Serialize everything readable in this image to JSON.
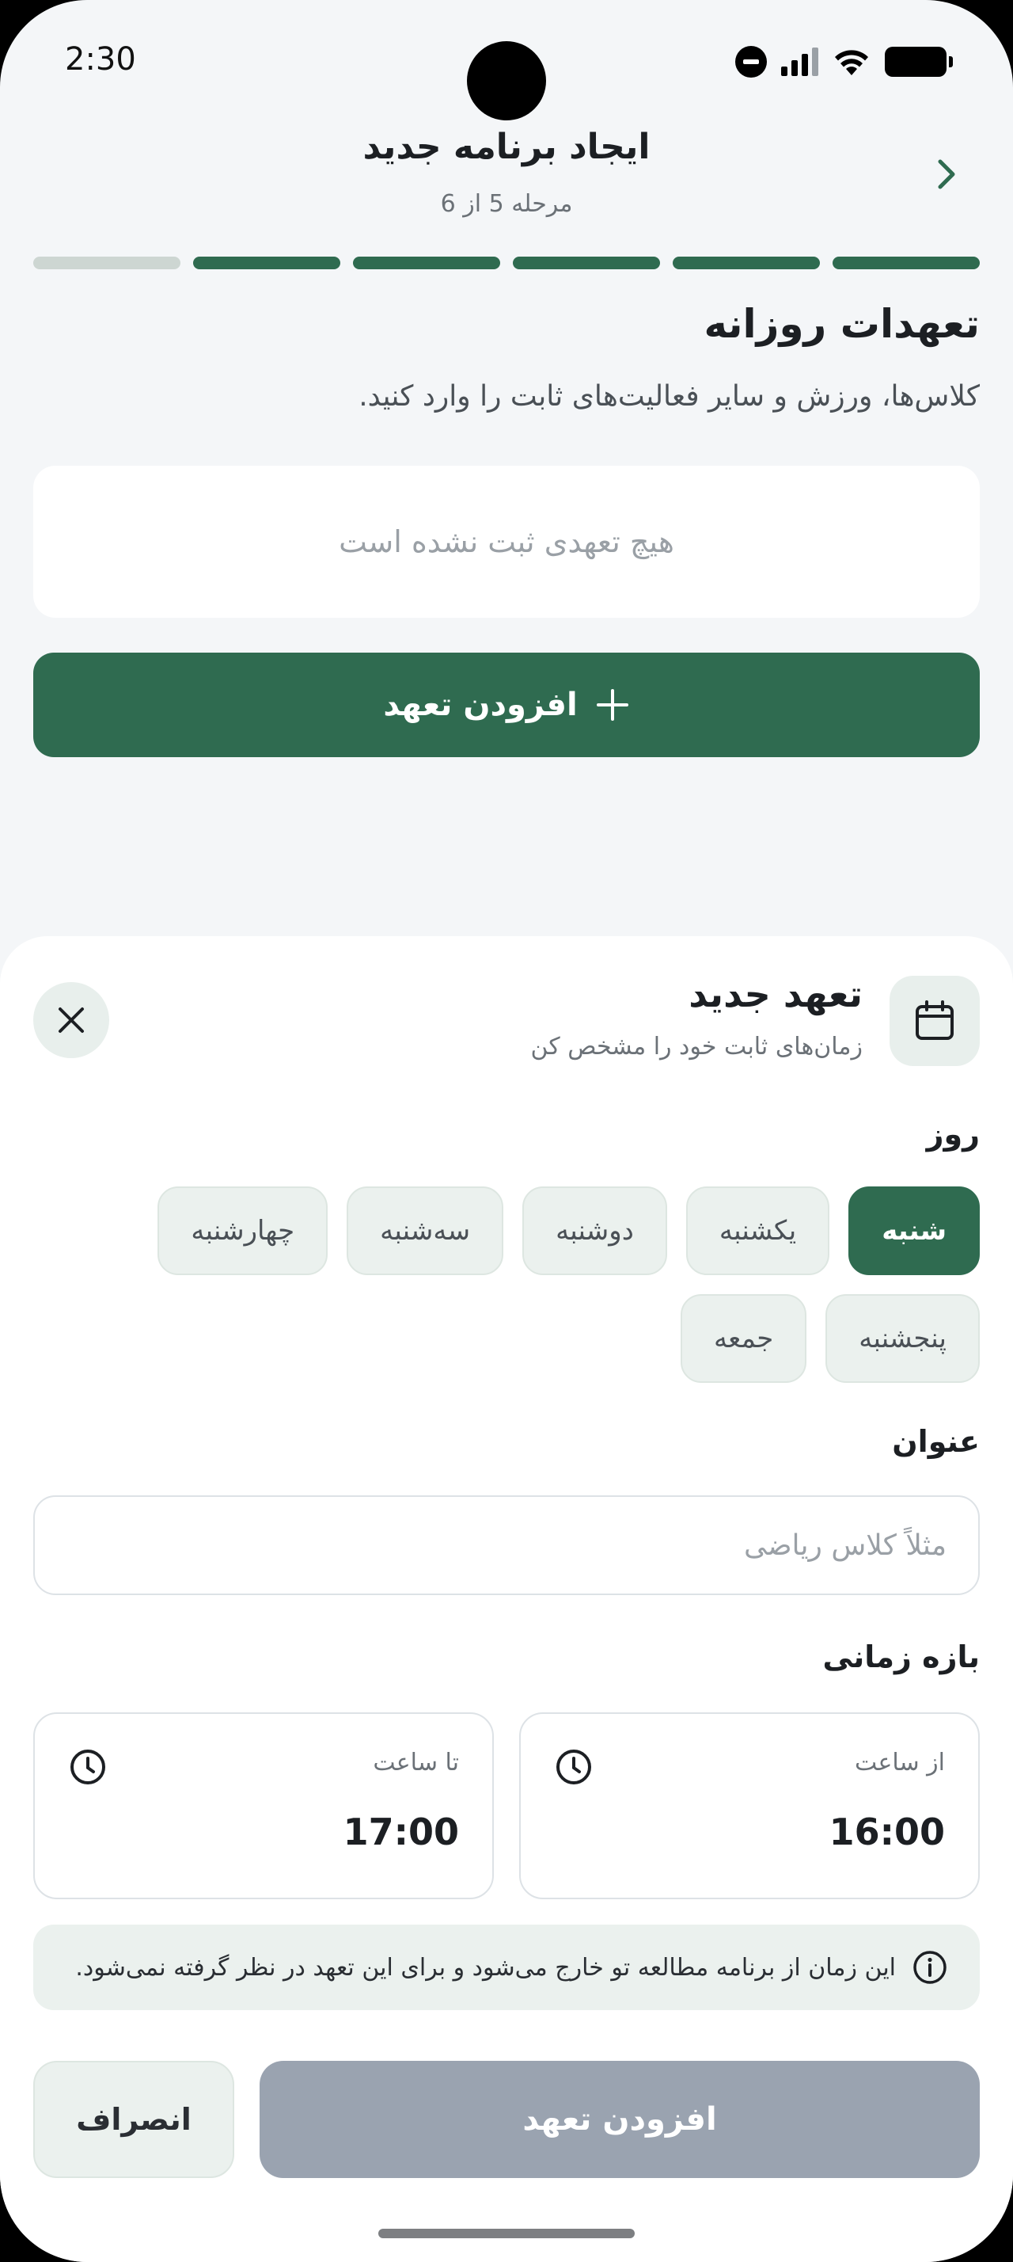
{
  "status_bar": {
    "time": "2:30"
  },
  "header": {
    "title": "ایجاد برنامه جدید",
    "step": "مرحله 5 از 6",
    "back_icon": "chevron-right-icon"
  },
  "progress": {
    "total_steps": 6,
    "current_step": 5
  },
  "section": {
    "title": "تعهدات روزانه",
    "description": "کلاس‌ها، ورزش و سایر فعالیت‌های ثابت را وارد کنید.",
    "empty_text": "هیچ تعهدی ثبت نشده است",
    "add_button": "افزودن تعهد"
  },
  "sheet": {
    "title": "تعهد جدید",
    "subtitle": "زمان‌های ثابت خود را مشخص کن",
    "icon": "calendar-icon",
    "close_icon": "close-icon",
    "day_label": "روز",
    "days": [
      "شنبه",
      "یکشنبه",
      "دوشنبه",
      "سه‌شنبه",
      "چهارشنبه",
      "پنجشنبه",
      "جمعه"
    ],
    "selected_day": "شنبه",
    "title_label": "عنوان",
    "title_placeholder": "مثلاً کلاس ریاضی",
    "time_label": "بازه زمانی",
    "from_label": "از ساعت",
    "from_value": "16:00",
    "to_label": "تا ساعت",
    "to_value": "17:00",
    "note": "این زمان از برنامه مطالعه تو خارج می‌شود و برای این تعهد در نظر گرفته نمی‌شود.",
    "submit_button": "افزودن تعهد",
    "cancel_button": "انصراف"
  },
  "colors": {
    "primary": "#2f6b50",
    "progress_inactive": "#cdd6d2",
    "disabled_button": "#9aa3b0",
    "chip_background": "#ebf1ee",
    "page_background": "#f4f6f8"
  }
}
